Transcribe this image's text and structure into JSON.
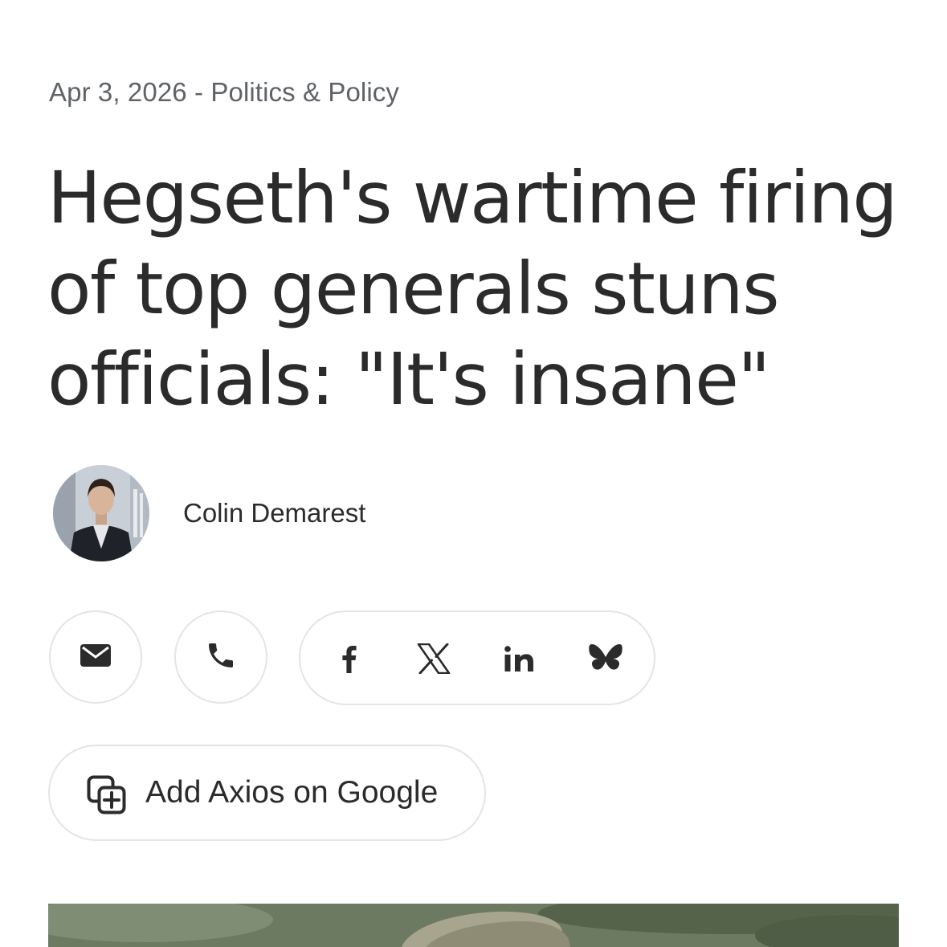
{
  "article": {
    "date": "Apr 3, 2026",
    "separator": " - ",
    "category": "Politics & Policy",
    "headline": "Hegseth's wartime firing of top generals stuns officials: \"It's insane\"",
    "author": "Colin Demarest"
  },
  "actions": {
    "email_icon": "envelope-icon",
    "phone_icon": "phone-icon",
    "share": [
      {
        "network": "facebook",
        "icon": "facebook-icon"
      },
      {
        "network": "x",
        "icon": "x-icon"
      },
      {
        "network": "linkedin",
        "icon": "linkedin-icon"
      },
      {
        "network": "bluesky",
        "icon": "bluesky-icon"
      }
    ],
    "add_google_label": "Add Axios on Google",
    "add_google_icon": "add-source-icon"
  },
  "colors": {
    "text": "#2b2b2b",
    "meta_text": "#5f6368",
    "pill_border": "#e4e4e4"
  }
}
